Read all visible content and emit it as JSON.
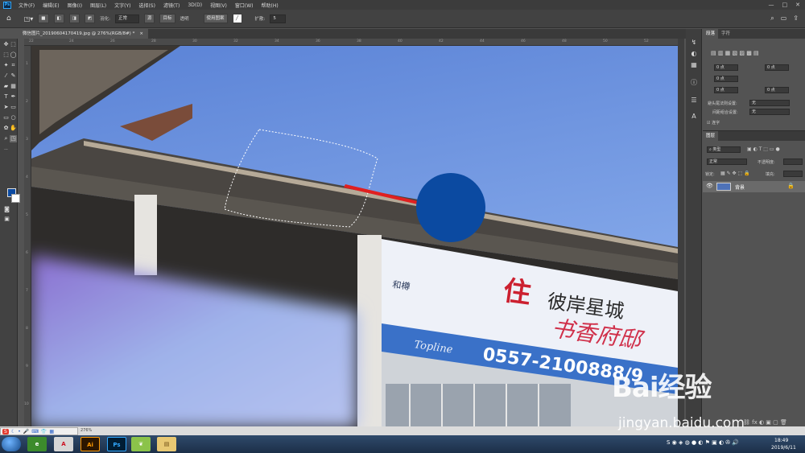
{
  "menubar": {
    "app_icon": "Ps",
    "items": [
      "文件(F)",
      "编辑(E)",
      "图像(I)",
      "图层(L)",
      "文字(Y)",
      "选择(S)",
      "滤镜(T)",
      "3D(D)",
      "视图(V)",
      "窗口(W)",
      "帮助(H)"
    ],
    "window_controls": [
      "—",
      "□",
      "✕"
    ]
  },
  "optionsbar": {
    "feather_label": "羽化:",
    "feather_value": "正常",
    "btn_a": "源",
    "btn_b": "目标",
    "transparent_label": "透明",
    "use_pattern_label": "使用图案",
    "diffusion_label": "扩散:",
    "diffusion_value": "5"
  },
  "document": {
    "tab_title": "微信图片_20190604170419.jpg @ 276%(RGB/8#) *",
    "close": "×"
  },
  "rulers": {
    "top_numbers": [
      "22",
      "24",
      "26",
      "28",
      "30",
      "32",
      "34",
      "36",
      "38",
      "40",
      "42",
      "44",
      "46",
      "48",
      "50",
      "52"
    ],
    "left_numbers": [
      "1",
      "2",
      "3",
      "4",
      "5",
      "6",
      "7",
      "8",
      "9",
      "10"
    ]
  },
  "canvas": {
    "billboard_line1_big": "住",
    "billboard_line1": "彼岸星城",
    "billboard_line2": "书香府邸",
    "billboard_small": "和樽",
    "billboard_phone": "0557-2100888/9",
    "billboard_en": "Topline"
  },
  "paragraph_panel": {
    "tabs": [
      "段落",
      "字符"
    ],
    "fields": [
      "0 点",
      "0 点",
      "0 点",
      "0 点",
      "0 点"
    ],
    "kinsoku_label": "避头尾法则设置:",
    "kinsoku_value": "无",
    "mojikumi_label": "间距组合设置:",
    "mojikumi_value": "无",
    "hyphenate_label": "连字"
  },
  "layers_panel": {
    "title": "图层",
    "filter_label": "类型",
    "blend_mode": "正常",
    "opacity_label": "不透明度:",
    "lock_label": "锁定:",
    "fill_label": "填充:",
    "layer_name": "背景"
  },
  "statusbar": {
    "zoom": "276%",
    "ime_logo": "S"
  },
  "taskbar": {
    "apps": [
      "Ai",
      "Ps"
    ],
    "time": "18:49",
    "date": "2019/6/11"
  },
  "watermark": {
    "brand": "Bai经验",
    "url": "jingyan.baidu.com"
  },
  "colors": {
    "foreground": "#0b4aa1",
    "background": "#ffffff",
    "circle": "#0b4aa1",
    "arrow": "#e02020",
    "sky": "#6b8fd8"
  }
}
